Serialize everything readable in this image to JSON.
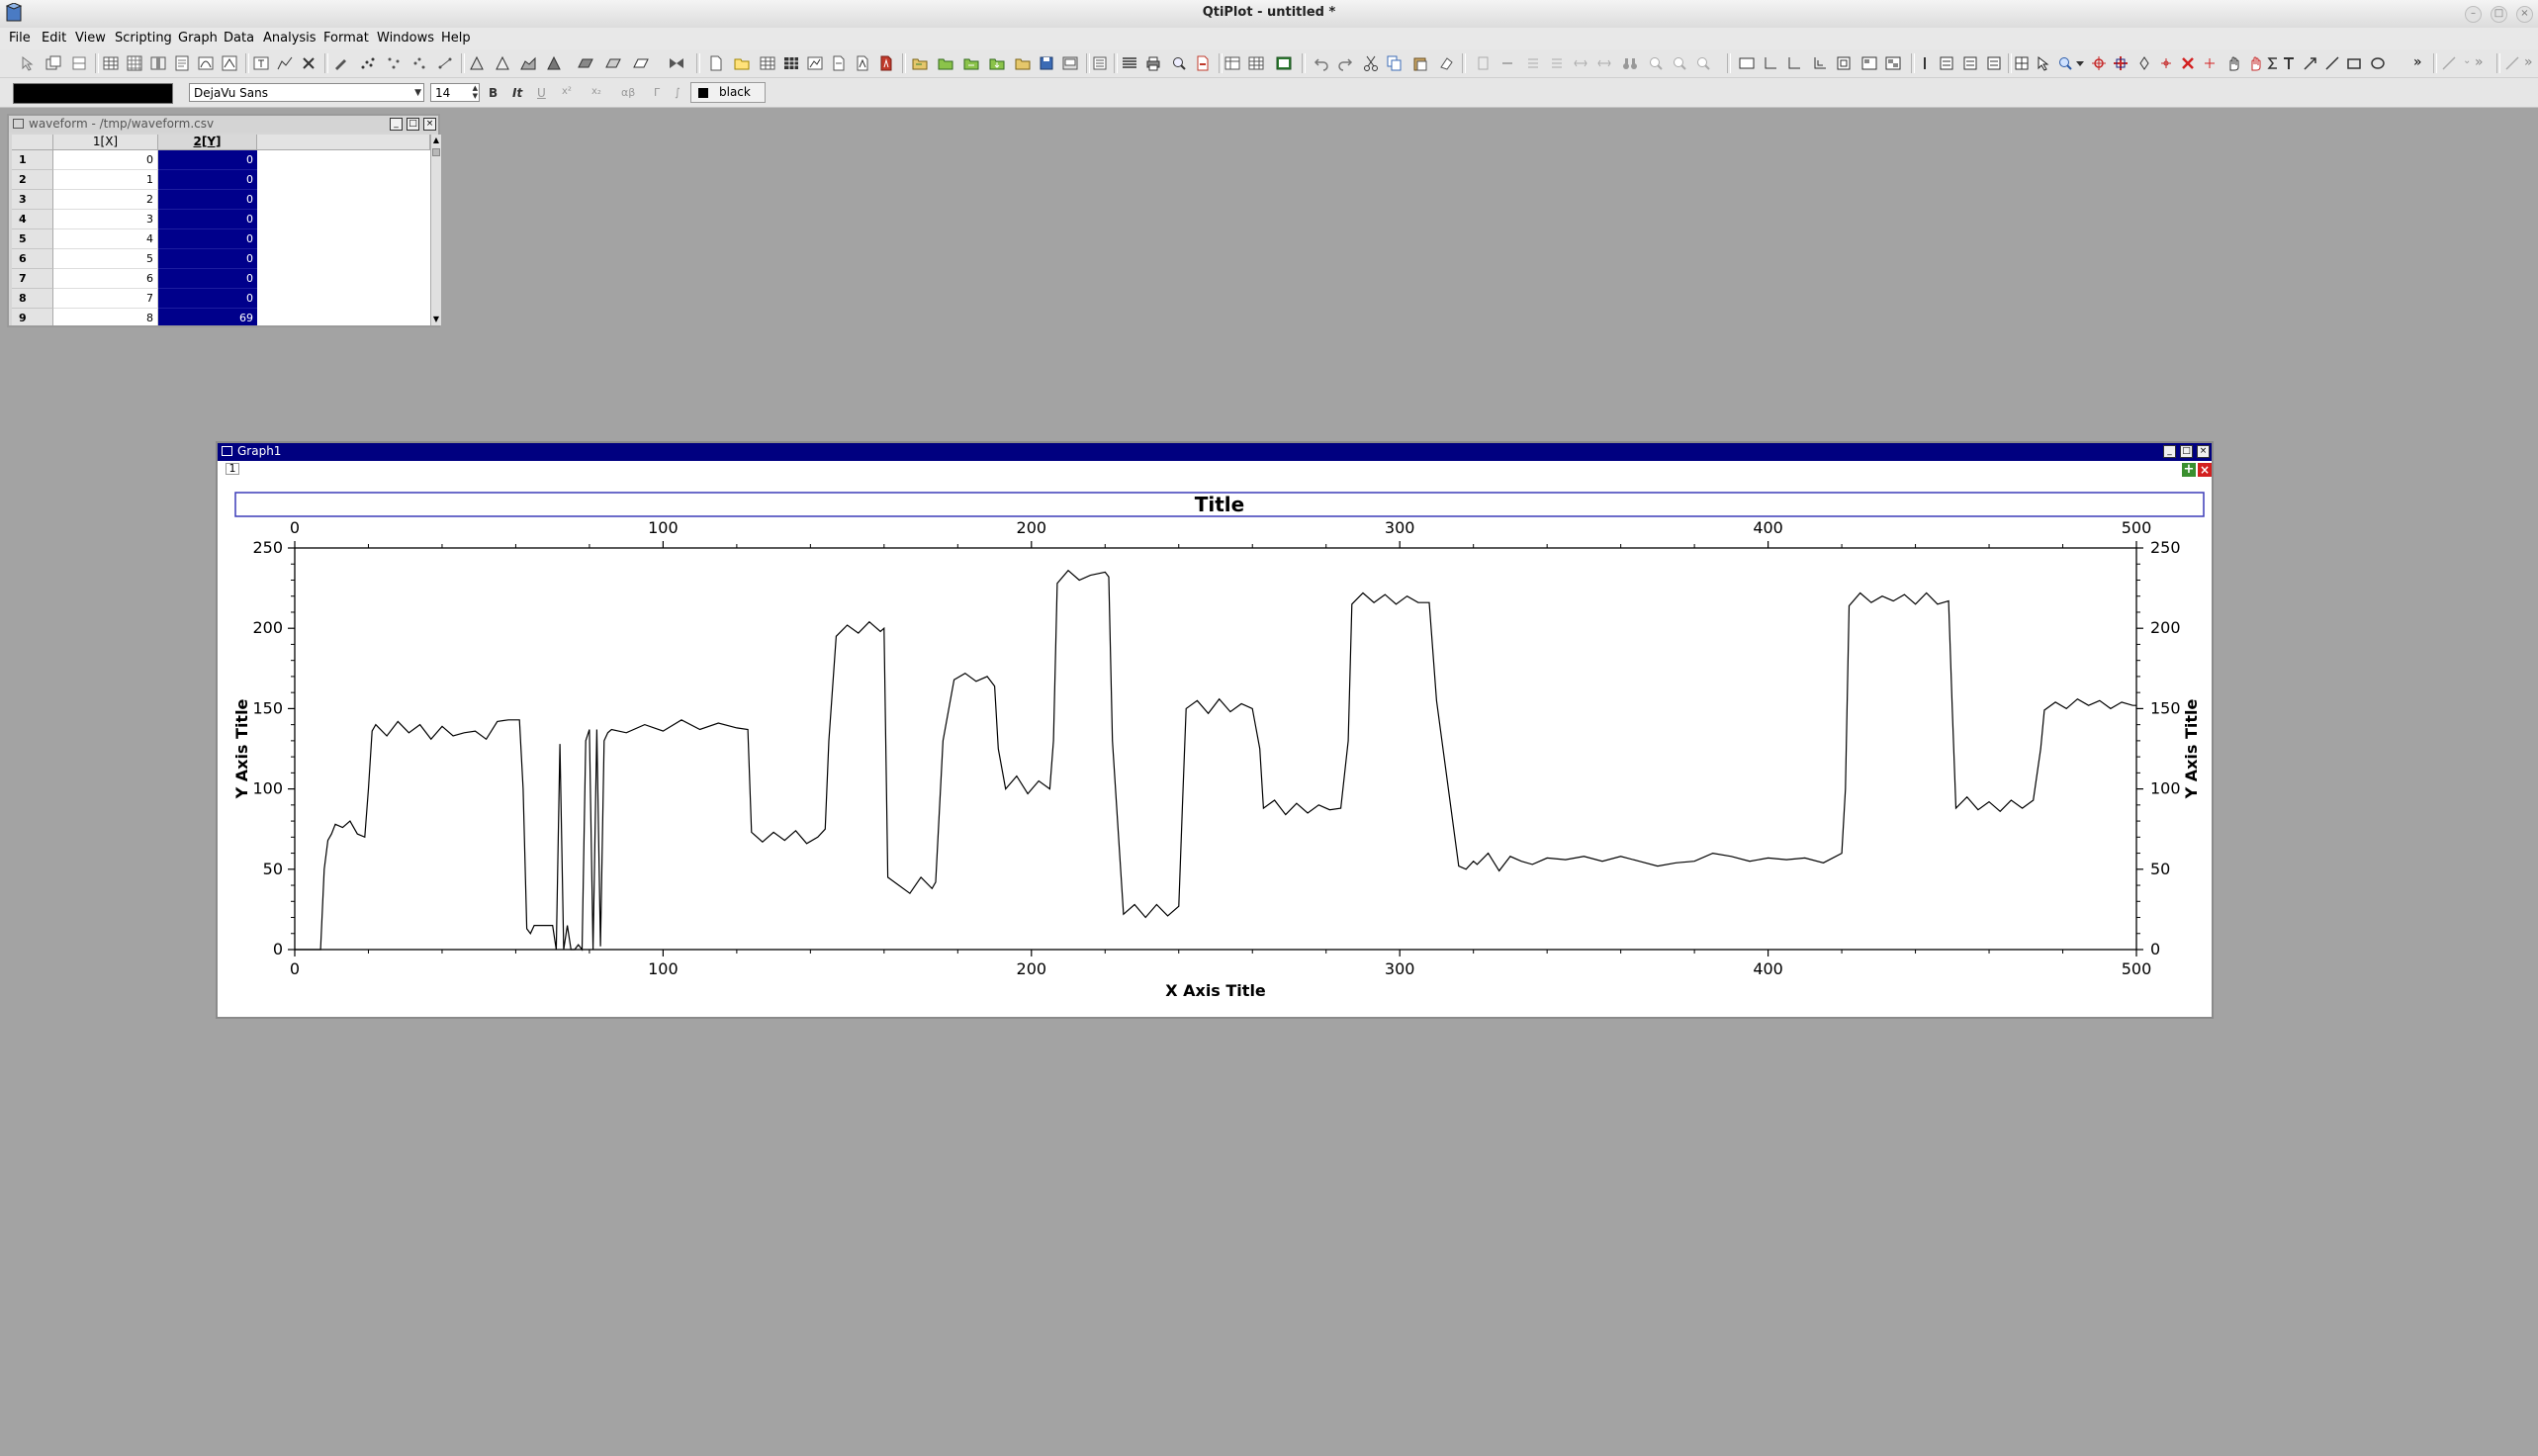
{
  "app": {
    "title": "QtiPlot - untitled *"
  },
  "menu": {
    "items": [
      {
        "label": "File",
        "name": "file"
      },
      {
        "label": "Edit",
        "name": "edit"
      },
      {
        "label": "View",
        "name": "view"
      },
      {
        "label": "Scripting",
        "name": "scripting"
      },
      {
        "label": "Graph",
        "name": "graph"
      },
      {
        "label": "Data",
        "name": "data"
      },
      {
        "label": "Analysis",
        "name": "analysis"
      },
      {
        "label": "Format",
        "name": "format"
      },
      {
        "label": "Windows",
        "name": "windows"
      },
      {
        "label": "Help",
        "name": "help"
      }
    ]
  },
  "format_toolbar": {
    "font": "DejaVu Sans",
    "size": "14",
    "bold": "B",
    "italic": "It",
    "underline": "U",
    "superscript": "x²",
    "subscript": "x₂",
    "greek": "αβ",
    "greek_upper": "Γ",
    "integral": "∫",
    "color_label": "black",
    "color_hex": "#000000"
  },
  "table_window": {
    "title": "waveform - /tmp/waveform.csv",
    "columns": [
      "1[X]",
      "2[Y]"
    ],
    "rows": [
      {
        "row": "1",
        "x": "0",
        "y": "0"
      },
      {
        "row": "2",
        "x": "1",
        "y": "0"
      },
      {
        "row": "3",
        "x": "2",
        "y": "0"
      },
      {
        "row": "4",
        "x": "3",
        "y": "0"
      },
      {
        "row": "5",
        "x": "4",
        "y": "0"
      },
      {
        "row": "6",
        "x": "5",
        "y": "0"
      },
      {
        "row": "7",
        "x": "6",
        "y": "0"
      },
      {
        "row": "8",
        "x": "7",
        "y": "0"
      },
      {
        "row": "9",
        "x": "8",
        "y": "69"
      }
    ]
  },
  "graph_window": {
    "title": "Graph1",
    "layer_label": "1",
    "accent_color": "#000080"
  },
  "chart_data": {
    "type": "line",
    "title": "Title",
    "xlabel": "X Axis Title",
    "ylabel": "Y Axis Title",
    "xlim": [
      0,
      500
    ],
    "ylim": [
      0,
      250
    ],
    "xticks": [
      "0",
      "100",
      "200",
      "300",
      "400",
      "500"
    ],
    "yticks": [
      "0",
      "50",
      "100",
      "150",
      "200",
      "250"
    ],
    "grid": false,
    "legend": "none",
    "series": [
      {
        "x": [
          0,
          7,
          8,
          9,
          10,
          11,
          13,
          15,
          17,
          19,
          20,
          21,
          22,
          25,
          28,
          31,
          34,
          37,
          40,
          43,
          46,
          49,
          52,
          55,
          58,
          61,
          62,
          63,
          64,
          65,
          70,
          71,
          72,
          73,
          74,
          75,
          76,
          77,
          78,
          79,
          80,
          81,
          82,
          83,
          84,
          85,
          86,
          90,
          95,
          100,
          105,
          110,
          115,
          120,
          123,
          124,
          127,
          130,
          133,
          136,
          139,
          142,
          144,
          145,
          147,
          150,
          153,
          156,
          159,
          160,
          161,
          164,
          167,
          170,
          173,
          174,
          176,
          179,
          182,
          185,
          188,
          190,
          191,
          193,
          196,
          199,
          202,
          205,
          206,
          207,
          210,
          213,
          216,
          220,
          221,
          222,
          225,
          228,
          231,
          234,
          237,
          240,
          241,
          242,
          245,
          248,
          251,
          254,
          257,
          260,
          262,
          263,
          266,
          269,
          272,
          275,
          278,
          281,
          284,
          286,
          287,
          290,
          293,
          296,
          299,
          302,
          305,
          308,
          310,
          316,
          318,
          320,
          321,
          324,
          327,
          330,
          333,
          336,
          340,
          345,
          350,
          355,
          360,
          365,
          370,
          375,
          380,
          385,
          390,
          395,
          400,
          405,
          410,
          415,
          420,
          421,
          422,
          425,
          428,
          431,
          434,
          437,
          440,
          443,
          446,
          449,
          450,
          451,
          454,
          457,
          460,
          463,
          466,
          469,
          472,
          474,
          475,
          478,
          481,
          484,
          487,
          490,
          493,
          496,
          499,
          500
        ],
        "y": [
          0,
          0,
          50,
          68,
          72,
          78,
          76,
          80,
          72,
          70,
          100,
          136,
          140,
          133,
          142,
          135,
          140,
          131,
          139,
          133,
          135,
          136,
          131,
          142,
          143,
          143,
          100,
          13,
          10,
          15,
          15,
          0,
          128,
          0,
          15,
          0,
          0,
          3,
          0,
          130,
          137,
          0,
          137,
          2,
          130,
          135,
          137,
          135,
          140,
          136,
          143,
          137,
          141,
          138,
          137,
          73,
          67,
          73,
          68,
          74,
          66,
          70,
          75,
          130,
          195,
          202,
          197,
          204,
          198,
          200,
          45,
          40,
          35,
          45,
          38,
          42,
          130,
          168,
          172,
          167,
          170,
          164,
          125,
          100,
          108,
          97,
          105,
          100,
          130,
          228,
          236,
          230,
          233,
          235,
          232,
          130,
          22,
          28,
          20,
          28,
          21,
          27,
          90,
          150,
          155,
          147,
          156,
          148,
          153,
          150,
          125,
          88,
          93,
          84,
          91,
          85,
          90,
          87,
          88,
          130,
          215,
          222,
          216,
          221,
          215,
          220,
          216,
          216,
          155,
          52,
          50,
          55,
          53,
          60,
          49,
          58,
          55,
          53,
          57,
          56,
          58,
          55,
          58,
          55,
          52,
          54,
          55,
          60,
          58,
          55,
          57,
          56,
          57,
          54,
          60,
          100,
          214,
          222,
          216,
          220,
          217,
          221,
          215,
          222,
          215,
          217,
          150,
          88,
          95,
          87,
          92,
          86,
          93,
          88,
          93,
          125,
          149,
          154,
          150,
          156,
          152,
          155,
          150,
          154,
          152,
          152
        ]
      }
    ]
  }
}
